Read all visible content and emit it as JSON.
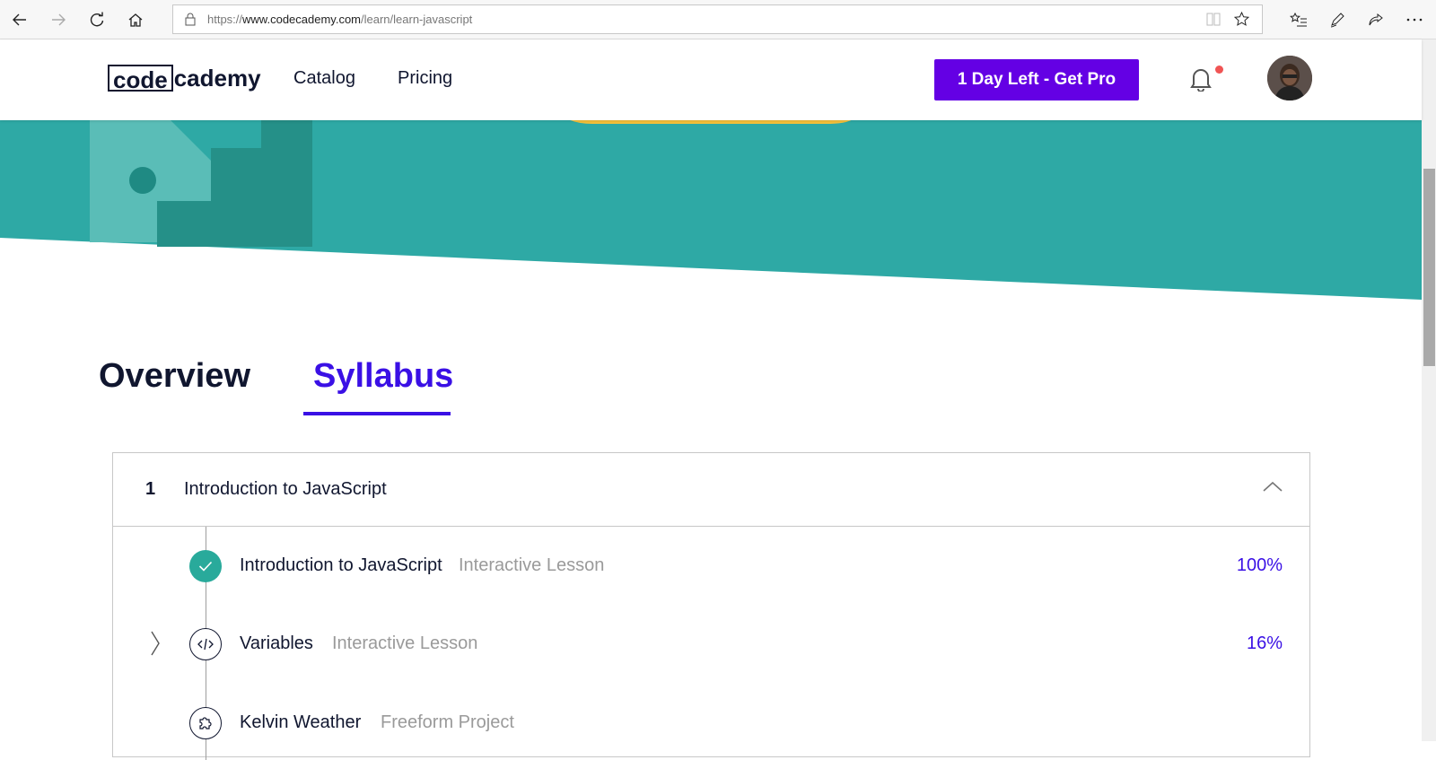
{
  "browser": {
    "url_prefix": "https://",
    "url_host": "www.codecademy.com",
    "url_path": "/learn/learn-javascript"
  },
  "header": {
    "logo_box": "code",
    "logo_rest": "cademy",
    "nav": [
      "Catalog",
      "Pricing"
    ],
    "pro_button": "1 Day Left - Get Pro"
  },
  "colors": {
    "hero_teal": "#2ea9a5",
    "accent_purple": "#3a10e5",
    "pro_button": "#6400e4"
  },
  "tabs": {
    "overview": "Overview",
    "syllabus": "Syllabus",
    "active": "Syllabus"
  },
  "syllabus": {
    "module": {
      "number": "1",
      "title": "Introduction to JavaScript"
    },
    "items": [
      {
        "title": "Introduction to JavaScript",
        "type": "Interactive Lesson",
        "progress": "100%",
        "icon": "check-icon"
      },
      {
        "title": "Variables",
        "type": "Interactive Lesson",
        "progress": "16%",
        "icon": "code-icon"
      },
      {
        "title": "Kelvin Weather",
        "type": "Freeform Project",
        "progress": "",
        "icon": "puzzle-icon"
      }
    ]
  }
}
